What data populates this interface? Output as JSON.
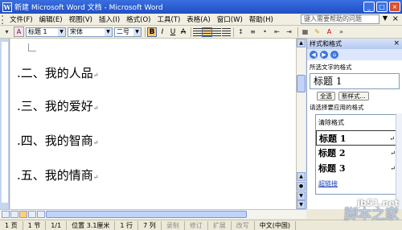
{
  "window": {
    "title": "新建 Microsoft Word 文档 - Microsoft Word",
    "app_icon": "W"
  },
  "menu": {
    "items": [
      "文件(F)",
      "编辑(E)",
      "视图(V)",
      "插入(I)",
      "格式(O)",
      "工具(T)",
      "表格(A)",
      "窗口(W)",
      "帮助(H)"
    ],
    "help_placeholder": "键入需要帮助的问题",
    "close": "×"
  },
  "toolbar": {
    "style_value": "标题 1",
    "font_value": "宋体",
    "size_value": "二号",
    "bold": "B",
    "italic": "I",
    "underline": "U",
    "strike": "A"
  },
  "document": {
    "headings": [
      ".二、我的人品",
      ".三、我的爱好",
      ".四、我的智商",
      ".五、我的情商"
    ],
    "paragraph_mark": "↵"
  },
  "pane": {
    "title": "样式和格式",
    "selected_text_label": "所选文字的格式",
    "current_style": "标题 1",
    "select_all_button": "全选",
    "new_style_button": "新样式...",
    "apply_label": "请选择要应用的格式",
    "styles": [
      "清除格式",
      "标题 1",
      "标题 2",
      "标题 3"
    ],
    "more_link": "超链接"
  },
  "status": {
    "page": "1 页",
    "section": "1 节",
    "page_of": "1/1",
    "position": "位置 3.1厘米",
    "line": "1 行",
    "column": "7 列",
    "rec": "录制",
    "trk": "修订",
    "ext": "扩展",
    "ovr": "改写",
    "lang": "中文(中国)"
  },
  "watermark": {
    "site": "jb51.net",
    "brand": "脚本之家"
  }
}
